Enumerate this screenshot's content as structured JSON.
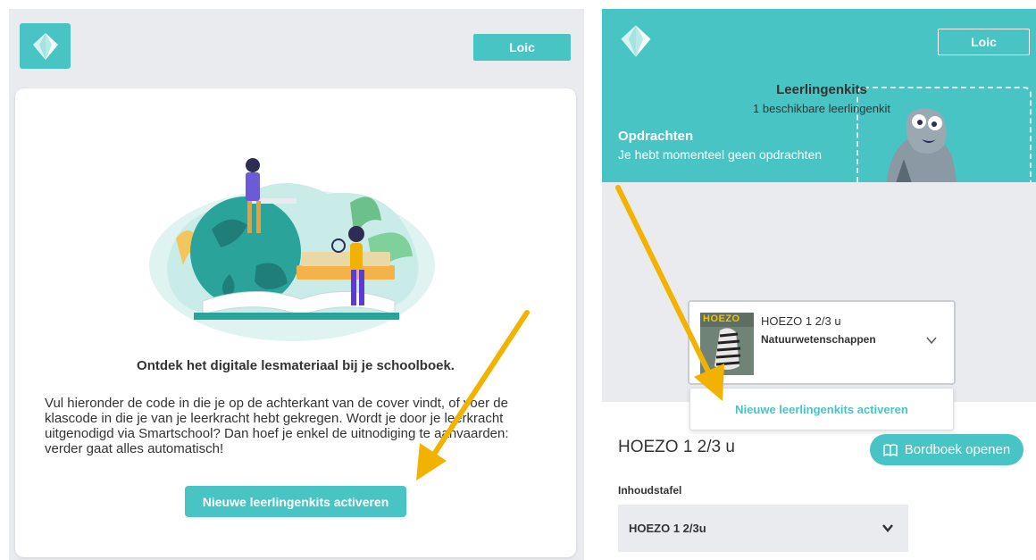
{
  "left": {
    "logo": "diamond-logo",
    "user_button": "Loic",
    "heading": "Ontdek het digitale lesmateriaal bij je schoolboek.",
    "body": "Vul hieronder de code in die je op de achterkant van de cover vindt, of voer de klascode in die je van je leerkracht hebt gekregen. Wordt je door je leerkracht uitgenodigd via Smartschool? Dan hoef je enkel de uitnodiging te aanvaarden: verder gaat alles automatisch!",
    "activate_button": "Nieuwe leerlingenkits activeren"
  },
  "right": {
    "user_button": "Loic",
    "hero": {
      "title": "Opdrachten",
      "subtitle": "Je hebt momenteel geen opdrachten"
    },
    "kits": {
      "title": "Leerlingenkits",
      "subtitle": "1 beschikbare leerlingenkit",
      "card": {
        "cover_label": "HOEZO",
        "name": "HOEZO 1 2/3 u",
        "subject": "Natuurwetenschappen"
      },
      "activate_option": "Nieuwe leerlingenkits activeren"
    },
    "book": {
      "title": "HOEZO 1 2/3 u",
      "bordboek_button": "Bordboek openen"
    },
    "toc": {
      "label": "Inhoudstafel",
      "value": "HOEZO 1 2/3u"
    }
  },
  "colors": {
    "accent": "#49c4c4",
    "panel_bg": "#e9ebee",
    "arrow": "#f2b300"
  },
  "icons": [
    "diamond-logo-icon",
    "chevron-down-icon",
    "book-icon",
    "arrow-annotation"
  ]
}
